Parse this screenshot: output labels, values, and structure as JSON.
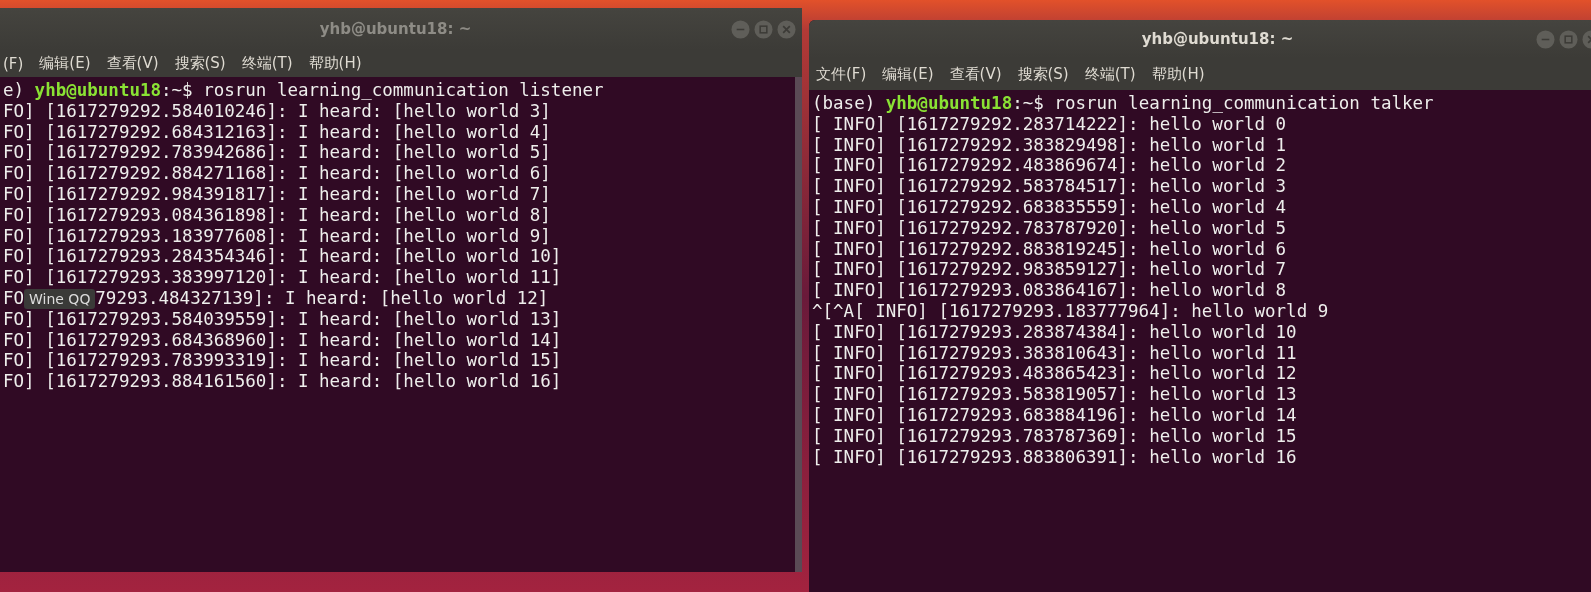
{
  "windows": [
    {
      "title": "yhb@ubuntu18: ~",
      "active": false,
      "scrollbar": true,
      "menu": [
        "(F)",
        "编辑(E)",
        "查看(V)",
        "搜索(S)",
        "终端(T)",
        "帮助(H)"
      ],
      "prompt": {
        "prefix": "e) ",
        "user": "yhb@ubuntu18",
        "rest": ":~$ rosrun learning_communication listener"
      },
      "lines": [
        {
          "kind": "plain",
          "text": "FO] [1617279292.584010246]: I heard: [hello world 3]"
        },
        {
          "kind": "plain",
          "text": "FO] [1617279292.684312163]: I heard: [hello world 4]"
        },
        {
          "kind": "plain",
          "text": "FO] [1617279292.783942686]: I heard: [hello world 5]"
        },
        {
          "kind": "plain",
          "text": "FO] [1617279292.884271168]: I heard: [hello world 6]"
        },
        {
          "kind": "plain",
          "text": "FO] [1617279292.984391817]: I heard: [hello world 7]"
        },
        {
          "kind": "plain",
          "text": "FO] [1617279293.084361898]: I heard: [hello world 8]"
        },
        {
          "kind": "plain",
          "text": "FO] [1617279293.183977608]: I heard: [hello world 9]"
        },
        {
          "kind": "plain",
          "text": "FO] [1617279293.284354346]: I heard: [hello world 10]"
        },
        {
          "kind": "plain",
          "text": "FO] [1617279293.383997120]: I heard: [hello world 11]"
        },
        {
          "kind": "covered",
          "head": "FO",
          "tooltip": "Wine QQ",
          "tail": "79293.484327139]: I heard: [hello world 12]"
        },
        {
          "kind": "plain",
          "text": "FO] [1617279293.584039559]: I heard: [hello world 13]"
        },
        {
          "kind": "plain",
          "text": "FO] [1617279293.684368960]: I heard: [hello world 14]"
        },
        {
          "kind": "plain",
          "text": "FO] [1617279293.783993319]: I heard: [hello world 15]"
        },
        {
          "kind": "plain",
          "text": "FO] [1617279293.884161560]: I heard: [hello world 16]"
        }
      ]
    },
    {
      "title": "yhb@ubuntu18: ~",
      "active": true,
      "scrollbar": false,
      "menu": [
        "文件(F)",
        "编辑(E)",
        "查看(V)",
        "搜索(S)",
        "终端(T)",
        "帮助(H)"
      ],
      "prompt": {
        "prefix": "(base) ",
        "user": "yhb@ubuntu18",
        "rest": ":~$ rosrun learning_communication talker"
      },
      "lines": [
        {
          "kind": "plain",
          "text": "[ INFO] [1617279292.283714222]: hello world 0"
        },
        {
          "kind": "plain",
          "text": "[ INFO] [1617279292.383829498]: hello world 1"
        },
        {
          "kind": "plain",
          "text": "[ INFO] [1617279292.483869674]: hello world 2"
        },
        {
          "kind": "plain",
          "text": "[ INFO] [1617279292.583784517]: hello world 3"
        },
        {
          "kind": "plain",
          "text": "[ INFO] [1617279292.683835559]: hello world 4"
        },
        {
          "kind": "plain",
          "text": "[ INFO] [1617279292.783787920]: hello world 5"
        },
        {
          "kind": "plain",
          "text": "[ INFO] [1617279292.883819245]: hello world 6"
        },
        {
          "kind": "plain",
          "text": "[ INFO] [1617279292.983859127]: hello world 7"
        },
        {
          "kind": "plain",
          "text": "[ INFO] [1617279293.083864167]: hello world 8"
        },
        {
          "kind": "plain",
          "text": "^[^A[ INFO] [1617279293.183777964]: hello world 9"
        },
        {
          "kind": "plain",
          "text": "[ INFO] [1617279293.283874384]: hello world 10"
        },
        {
          "kind": "plain",
          "text": "[ INFO] [1617279293.383810643]: hello world 11"
        },
        {
          "kind": "plain",
          "text": "[ INFO] [1617279293.483865423]: hello world 12"
        },
        {
          "kind": "plain",
          "text": "[ INFO] [1617279293.583819057]: hello world 13"
        },
        {
          "kind": "plain",
          "text": "[ INFO] [1617279293.683884196]: hello world 14"
        },
        {
          "kind": "plain",
          "text": "[ INFO] [1617279293.783787369]: hello world 15"
        },
        {
          "kind": "plain",
          "text": "[ INFO] [1617279293.883806391]: hello world 16"
        }
      ]
    }
  ]
}
